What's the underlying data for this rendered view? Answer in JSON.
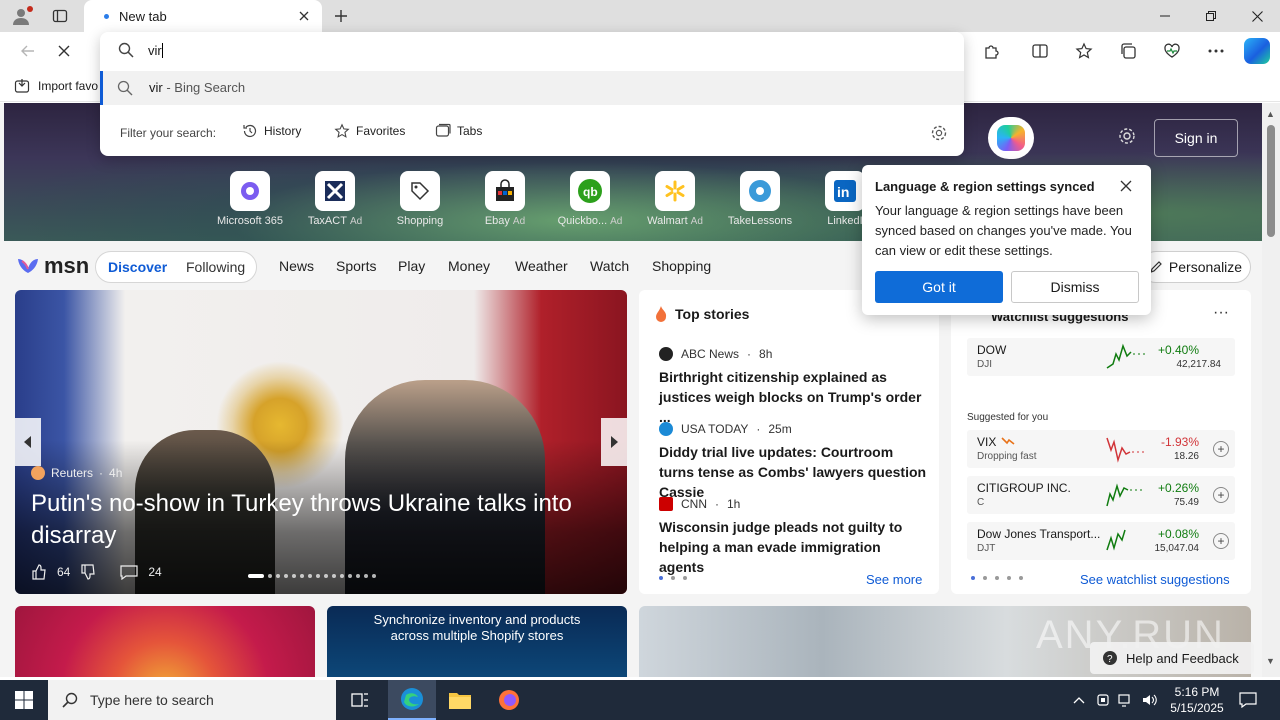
{
  "browser": {
    "tab_title": "New tab",
    "favorites_bar": {
      "import_label": "Import favo"
    }
  },
  "address_bar": {
    "typed_text": "vir",
    "suggestion": {
      "query": "vir",
      "suffix": " - Bing Search"
    },
    "filter_label": "Filter your search:",
    "filters": [
      "History",
      "Favorites",
      "Tabs"
    ]
  },
  "page": {
    "signin_label": "Sign in",
    "shortcuts": [
      {
        "label": "Microsoft 365",
        "ad": ""
      },
      {
        "label": "TaxACT",
        "ad": "Ad"
      },
      {
        "label": "Shopping",
        "ad": ""
      },
      {
        "label": "Ebay",
        "ad": "Ad"
      },
      {
        "label": "Quickbo...",
        "ad": "Ad"
      },
      {
        "label": "Walmart",
        "ad": "Ad"
      },
      {
        "label": "TakeLessons",
        "ad": ""
      },
      {
        "label": "LinkedI",
        "ad": ""
      }
    ],
    "msn": {
      "logo_text": "msn",
      "discover": "Discover",
      "following": "Following",
      "nav": [
        "News",
        "Sports",
        "Play",
        "Money",
        "Weather",
        "Watch",
        "Shopping"
      ],
      "personalize": "Personalize"
    },
    "hero": {
      "source": "Reuters",
      "age": "4h",
      "title": "Putin's no-show in Turkey throws Ukraine talks into disarray",
      "likes": "64",
      "comments": "24"
    },
    "top_stories": {
      "title": "Top stories",
      "items": [
        {
          "source": "ABC News",
          "age": "8h",
          "headline": "Birthright citizenship explained as justices weigh blocks on Trump's order ..."
        },
        {
          "source": "USA TODAY",
          "age": "25m",
          "headline": "Diddy trial live updates: Courtroom turns tense as Combs' lawyers question Cassie"
        },
        {
          "source": "CNN",
          "age": "1h",
          "headline": "Wisconsin judge pleads not guilty to helping a man evade immigration agents"
        }
      ],
      "see_more": "See more"
    },
    "watchlist": {
      "title": "Watchlist suggestions",
      "suggested_label": "Suggested for you",
      "rows": [
        {
          "name": "DOW",
          "sub": "DJI",
          "change": "+0.40%",
          "price": "42,217.84",
          "trend": "up",
          "note": ""
        },
        {
          "name": "VIX",
          "sub": "Dropping fast",
          "change": "-1.93%",
          "price": "18.26",
          "trend": "down",
          "note": ""
        },
        {
          "name": "CITIGROUP INC.",
          "sub": "C",
          "change": "+0.26%",
          "price": "75.49",
          "trend": "up",
          "note": ""
        },
        {
          "name": "Dow Jones Transport...",
          "sub": "DJT",
          "change": "+0.08%",
          "price": "15,047.04",
          "trend": "up",
          "note": ""
        }
      ],
      "see_link": "See watchlist suggestions"
    },
    "tiles": {
      "shopify_text": "Synchronize inventory and products across multiple Shopify stores"
    },
    "watermark": "ANY.RUN",
    "help_label": "Help and Feedback"
  },
  "language_popup": {
    "title": "Language & region settings synced",
    "body": "Your language & region settings have been synced based on changes you've made. You can view or edit these settings.",
    "primary": "Got it",
    "secondary": "Dismiss"
  },
  "taskbar": {
    "search_placeholder": "Type here to search",
    "time": "5:16 PM",
    "date": "5/15/2025"
  },
  "colors": {
    "accent": "#0f5bd5",
    "primary_button": "#0f6cd8",
    "up": "#107c10",
    "down": "#d13438",
    "taskbar": "#1f2a3a"
  }
}
